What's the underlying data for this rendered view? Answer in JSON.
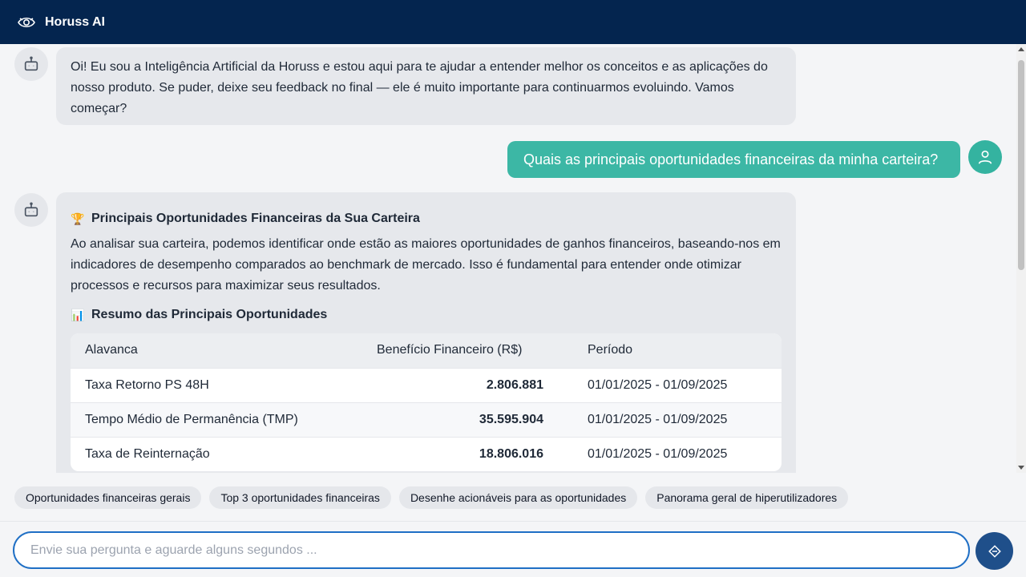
{
  "app": {
    "title": "Horuss AI",
    "logo_icon": "eye-icon"
  },
  "colors": {
    "header": "#04254f",
    "accent": "#3cb7a5",
    "send_button": "#1f4f8a"
  },
  "messages": {
    "greeting": "Oi! Eu sou a Inteligência Artificial da Horuss e estou aqui para te ajudar a entender melhor os conceitos e as aplicações do nosso produto. Se puder, deixe seu feedback no final — ele é muito importante para continuarmos evoluindo. Vamos começar?",
    "user_question": "Quais as principais oportunidades financeiras da minha carteira?",
    "answer": {
      "heading_emoji": "🏆",
      "heading": "Principais Oportunidades Financeiras da Sua Carteira",
      "intro": "Ao analisar sua carteira, podemos identificar onde estão as maiores oportunidades de ganhos financeiros, baseando-nos em indicadores de desempenho comparados ao benchmark de mercado. Isso é fundamental para entender onde otimizar processos e recursos para maximizar seus resultados.",
      "summary_emoji": "📊",
      "summary_heading": "Resumo das Principais Oportunidades",
      "table": {
        "headers": [
          "Alavanca",
          "Benefício Financeiro (R$)",
          "Período"
        ],
        "rows": [
          [
            "Taxa Retorno PS 48H",
            "2.806.881",
            "01/01/2025 - 01/09/2025"
          ],
          [
            "Tempo Médio de Permanência (TMP)",
            "35.595.904",
            "01/01/2025 - 01/09/2025"
          ],
          [
            "Taxa de Reinternação",
            "18.806.016",
            "01/01/2025 - 01/09/2025"
          ]
        ]
      }
    }
  },
  "suggestions": [
    "Oportunidades financeiras gerais",
    "Top 3 oportunidades financeiras",
    "Desenhe acionáveis para as oportunidades",
    "Panorama geral de hiperutilizadores"
  ],
  "input": {
    "placeholder": "Envie sua pergunta e aguarde alguns segundos ...",
    "value": ""
  }
}
